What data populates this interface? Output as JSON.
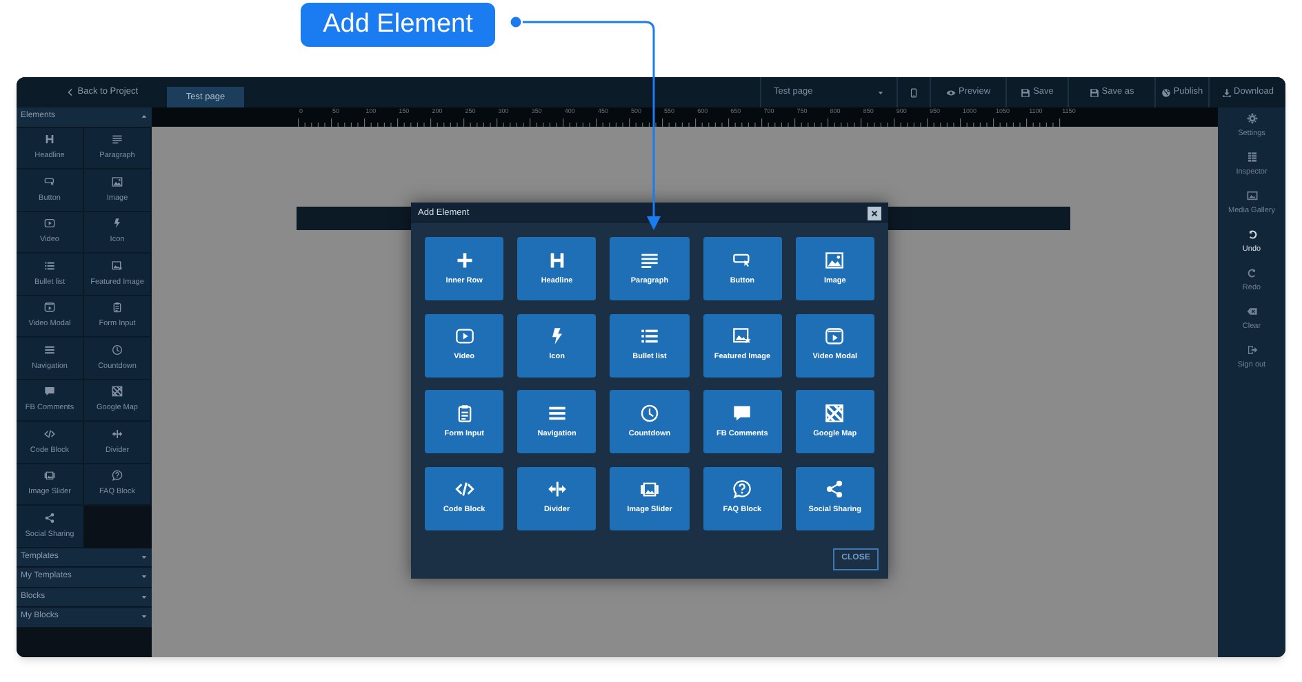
{
  "callout": {
    "label": "Add Element"
  },
  "topbar": {
    "back": "Back to Project",
    "tabs": [
      {
        "label": "Test page",
        "selected": true
      }
    ],
    "page_select": {
      "value": "Test page"
    },
    "actions": [
      {
        "label": "Preview"
      },
      {
        "label": "Save"
      },
      {
        "label": "Save as"
      },
      {
        "label": "Publish"
      },
      {
        "label": "Download"
      }
    ]
  },
  "ruler": {
    "labels": [
      "0",
      "50",
      "100",
      "150",
      "200",
      "250",
      "300",
      "350",
      "400",
      "450",
      "500",
      "550",
      "600",
      "650",
      "700",
      "750",
      "800",
      "850",
      "900",
      "950",
      "1000",
      "1050",
      "1100",
      "1150"
    ]
  },
  "sidebar": {
    "sections": [
      {
        "title": "Elements",
        "expanded": true,
        "items": [
          "Headline",
          "Paragraph",
          "Button",
          "Image",
          "Video",
          "Icon",
          "Bullet list",
          "Featured Image",
          "Video Modal",
          "Form Input",
          "Navigation",
          "Countdown",
          "FB Comments",
          "Google Map",
          "Code Block",
          "Divider",
          "Image Slider",
          "FAQ Block",
          "Social Sharing"
        ]
      },
      {
        "title": "Templates",
        "expanded": false
      },
      {
        "title": "My Templates",
        "expanded": false
      },
      {
        "title": "Blocks",
        "expanded": false
      },
      {
        "title": "My Blocks",
        "expanded": false
      }
    ]
  },
  "right_panel": {
    "items": [
      {
        "label": "Settings",
        "active": false
      },
      {
        "label": "Inspector",
        "active": false
      },
      {
        "label": "Media Gallery",
        "active": false
      },
      {
        "label": "Undo",
        "active": true
      },
      {
        "label": "Redo",
        "active": false
      },
      {
        "label": "Clear",
        "active": false
      },
      {
        "label": "Sign out",
        "active": false
      }
    ]
  },
  "modal": {
    "title": "Add Element",
    "tiles": [
      "Inner Row",
      "Headline",
      "Paragraph",
      "Button",
      "Image",
      "Video",
      "Icon",
      "Bullet list",
      "Featured Image",
      "Video Modal",
      "Form Input",
      "Navigation",
      "Countdown",
      "FB Comments",
      "Google Map",
      "Code Block",
      "Divider",
      "Image Slider",
      "FAQ Block",
      "Social Sharing"
    ],
    "close_button": "CLOSE"
  }
}
